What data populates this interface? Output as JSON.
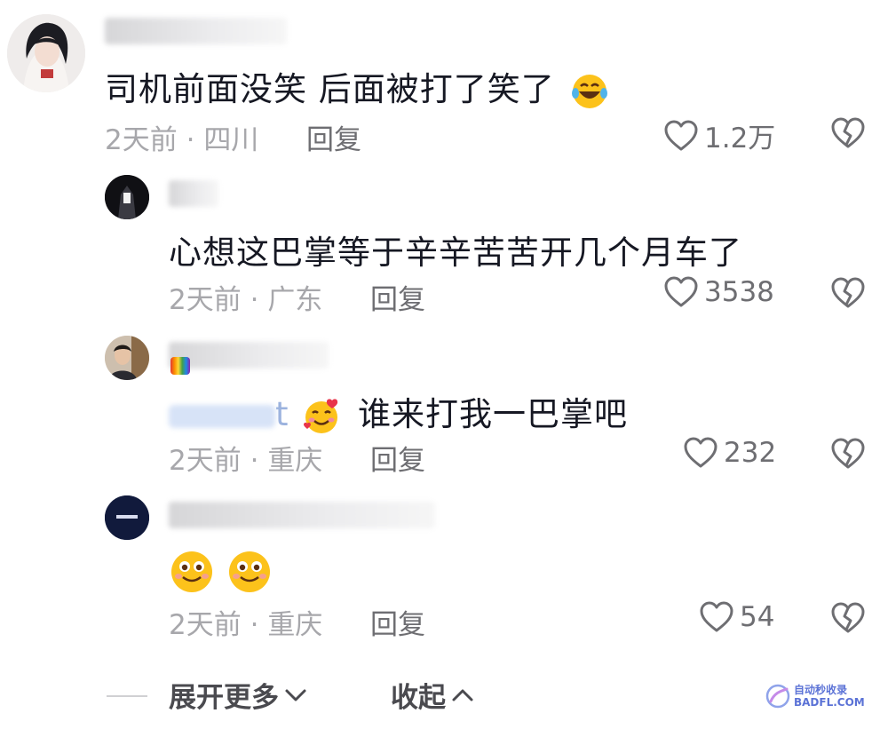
{
  "comments": [
    {
      "text": "司机前面没笑 后面被打了笑了",
      "emoji": "rofl-emoji",
      "time": "2天前",
      "location": "四川",
      "reply_label": "回复",
      "likes": "1.2万"
    },
    {
      "text": "心想这巴掌等于辛辛苦苦开几个月车了",
      "time": "2天前",
      "location": "广东",
      "reply_label": "回复",
      "likes": "3538"
    },
    {
      "mention_suffix": "t",
      "text": "谁来打我一巴掌吧",
      "emoji": "smiling-face-with-hearts-emoji",
      "time": "2天前",
      "location": "重庆",
      "reply_label": "回复",
      "likes": "232"
    },
    {
      "text": "",
      "emojis": [
        "blushing-smile-emoji",
        "blushing-smile-emoji"
      ],
      "time": "2天前",
      "location": "重庆",
      "reply_label": "回复",
      "likes": "54"
    }
  ],
  "separator": "·",
  "footer": {
    "expand_label": "展开更多",
    "collapse_label": "收起"
  },
  "watermark": {
    "line1": "自动秒收录",
    "line2": "BADFL.COM"
  },
  "colors": {
    "text": "#161823",
    "meta": "#a7a7ab",
    "action": "#6e6e72",
    "watermark": "#5b72d6"
  }
}
